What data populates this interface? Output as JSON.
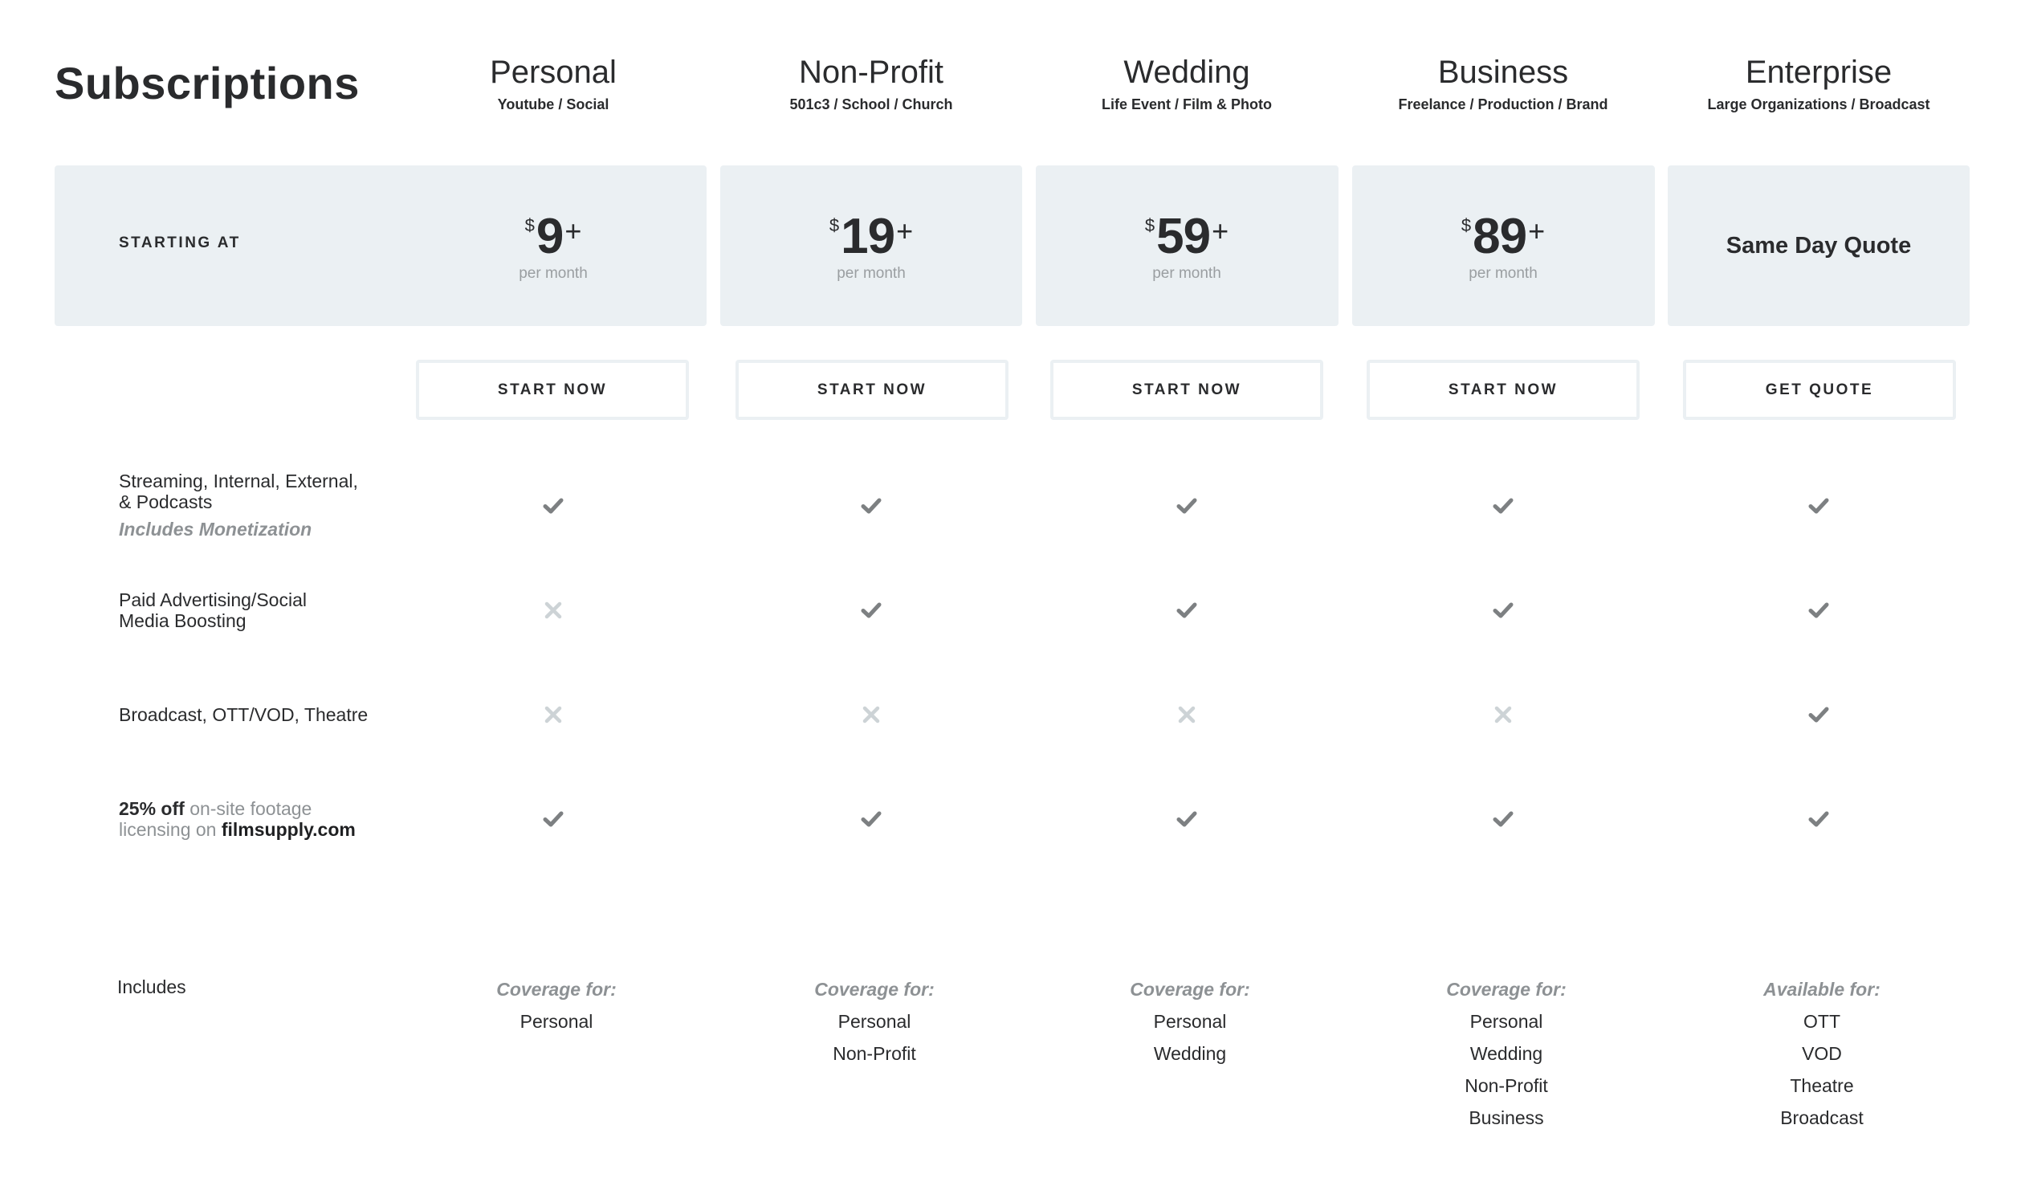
{
  "page": {
    "title": "Subscriptions",
    "starting_at_label": "STARTING AT",
    "includes_label": "Includes"
  },
  "colors": {
    "panel_bg": "#ebf0f3",
    "text_primary": "#2a2b2d",
    "text_muted": "#8d9194",
    "check": "#7d8082",
    "cross": "#cdd3d6"
  },
  "plans": [
    {
      "name": "Personal",
      "subtitle": "Youtube / Social",
      "price": {
        "currency": "$",
        "amount": "9",
        "suffix": "+",
        "period": "per month"
      },
      "cta": "START NOW",
      "features": [
        "check",
        "cross",
        "cross",
        "check"
      ],
      "includes": {
        "heading": "Coverage for:",
        "items": [
          "Personal"
        ]
      }
    },
    {
      "name": "Non-Profit",
      "subtitle": "501c3 / School / Church",
      "price": {
        "currency": "$",
        "amount": "19",
        "suffix": "+",
        "period": "per month"
      },
      "cta": "START NOW",
      "features": [
        "check",
        "check",
        "cross",
        "check"
      ],
      "includes": {
        "heading": "Coverage for:",
        "items": [
          "Personal",
          "Non-Profit"
        ]
      }
    },
    {
      "name": "Wedding",
      "subtitle": "Life Event / Film & Photo",
      "price": {
        "currency": "$",
        "amount": "59",
        "suffix": "+",
        "period": "per month"
      },
      "cta": "START NOW",
      "features": [
        "check",
        "check",
        "cross",
        "check"
      ],
      "includes": {
        "heading": "Coverage for:",
        "items": [
          "Personal",
          "Wedding"
        ]
      }
    },
    {
      "name": "Business",
      "subtitle": "Freelance / Production / Brand",
      "price": {
        "currency": "$",
        "amount": "89",
        "suffix": "+",
        "period": "per month"
      },
      "cta": "START NOW",
      "features": [
        "check",
        "check",
        "cross",
        "check"
      ],
      "includes": {
        "heading": "Coverage for:",
        "items": [
          "Personal",
          "Wedding",
          "Non-Profit",
          "Business"
        ]
      }
    },
    {
      "name": "Enterprise",
      "subtitle": "Large Organizations / Broadcast",
      "price": {
        "quote_text": "Same Day Quote"
      },
      "cta": "GET QUOTE",
      "features": [
        "check",
        "check",
        "check",
        "check"
      ],
      "includes": {
        "heading": "Available for:",
        "items": [
          "OTT",
          "VOD",
          "Theatre",
          "Broadcast"
        ]
      }
    }
  ],
  "features": [
    {
      "label": "Streaming, Internal, External,",
      "label_line2": "& Podcasts",
      "note": "Includes Monetization"
    },
    {
      "label": "Paid Advertising/Social",
      "label_line2": "Media Boosting"
    },
    {
      "label": "Broadcast, OTT/VOD, Theatre"
    },
    {
      "strong": "25% off",
      "muted": "on-site footage",
      "muted2": "licensing on",
      "link": "filmsupply.com"
    }
  ]
}
